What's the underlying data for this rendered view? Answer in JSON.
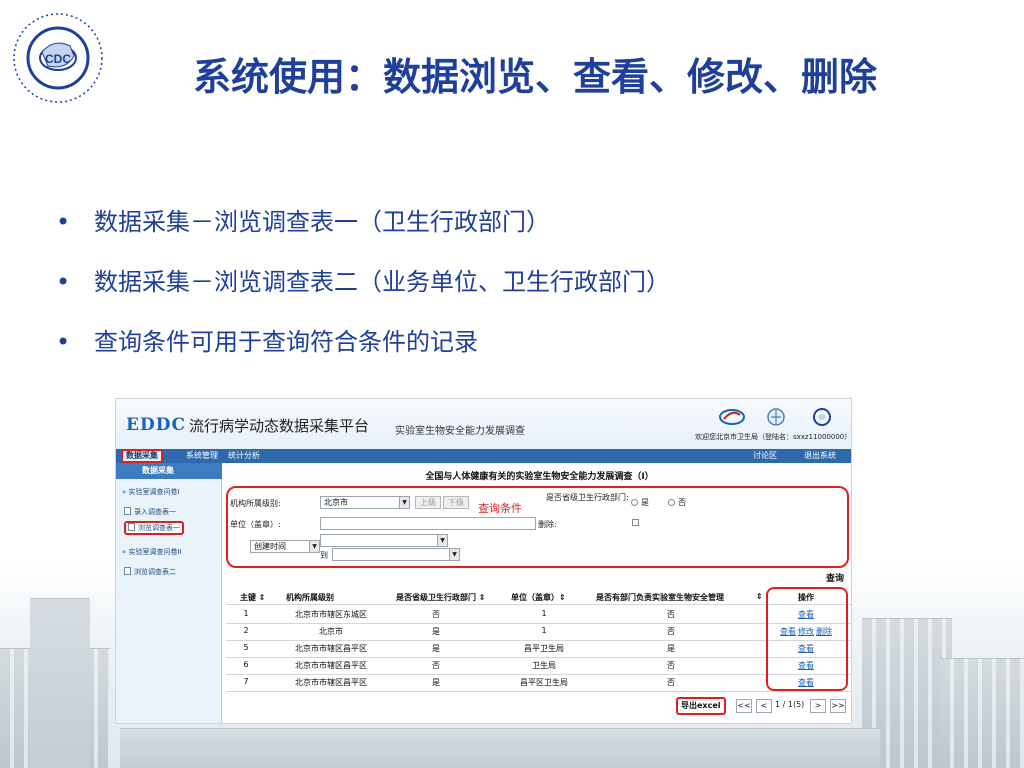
{
  "slide": {
    "title": "系统使用：数据浏览、查看、修改、删除",
    "bullets": [
      "数据采集－浏览调查表一（卫生行政部门）",
      "数据采集－浏览调查表二（业务单位、卫生行政部门）",
      "查询条件可用于查询符合条件的记录"
    ],
    "bullet_symbol": "•",
    "logo_text": "CDC"
  },
  "app": {
    "brand_code": "EDDC",
    "brand_name": "流行病学动态数据采集平台",
    "brand_sub": "实验室生物安全能力发展调查",
    "welcome": "欢迎您北京市卫生局（登陆名：sxxz11000000）",
    "menu": [
      "数据采集",
      "系统管理",
      "统计分析",
      "讨论区",
      "退出系统"
    ],
    "sidebar": {
      "head": "数据采集",
      "group1": "» 实验室调查问卷I",
      "item1": "录入调查表一",
      "item2": "浏览调查表一",
      "group2": "» 实验室调查问卷II",
      "item3": "浏览调查表二"
    },
    "main_title": "全国与人体健康有关的实验室生物安全能力发展调查（I）",
    "query": {
      "level_label": "机构所属级别:",
      "level_value": "北京市",
      "btn_up": "上级",
      "btn_down": "下级",
      "province_label": "是否省级卫生行政部门:",
      "yes": "是",
      "no": "否",
      "unit_label": "单位（盖章）:",
      "delete_label": "删除:",
      "date_select": "创建时间",
      "to": "到",
      "annotation": "查询条件",
      "search": "查询"
    },
    "table": {
      "headers": [
        "主键 ⇕",
        "机构所属级别",
        "是否省级卫生行政部门 ⇕",
        "单位（盖章）⇕",
        "是否有部门负责实验室生物安全管理",
        "⇕",
        "操作"
      ],
      "rows": [
        {
          "id": "1",
          "level": "北京市市辖区东城区",
          "province": "否",
          "unit": "1",
          "dept": "否",
          "ops": [
            "查看"
          ]
        },
        {
          "id": "2",
          "level": "北京市",
          "province": "是",
          "unit": "1",
          "dept": "否",
          "ops": [
            "查看",
            "修改",
            "删除"
          ]
        },
        {
          "id": "5",
          "level": "北京市市辖区昌平区",
          "province": "是",
          "unit": "昌平卫生局",
          "dept": "是",
          "ops": [
            "查看"
          ]
        },
        {
          "id": "6",
          "level": "北京市市辖区昌平区",
          "province": "否",
          "unit": "卫生局",
          "dept": "否",
          "ops": [
            "查看"
          ]
        },
        {
          "id": "7",
          "level": "北京市市辖区昌平区",
          "province": "是",
          "unit": "昌平区卫生局",
          "dept": "否",
          "ops": [
            "查看"
          ]
        }
      ]
    },
    "pager": {
      "export": "导出excel",
      "first": "<<",
      "prev": "<",
      "info": "1 / 1(5)",
      "next": ">",
      "last": ">>"
    }
  },
  "colors": {
    "title_blue": "#1f3f9a",
    "menu_blue": "#2d69ab",
    "highlight_red": "#e02020",
    "link_blue": "#1a5fb4"
  }
}
